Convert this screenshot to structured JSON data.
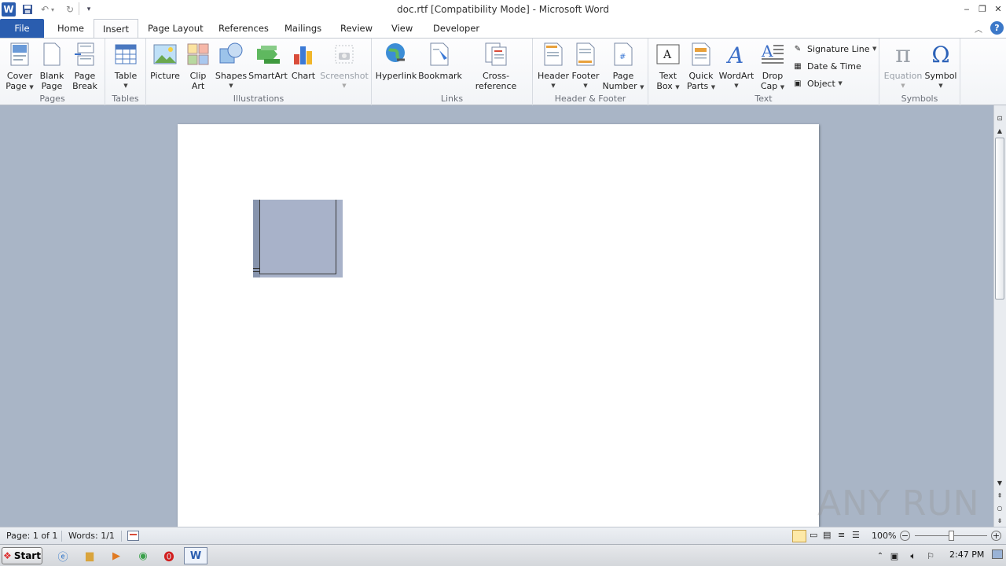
{
  "window": {
    "title": "doc.rtf [Compatibility Mode] - Microsoft Word"
  },
  "quick_access": {
    "customize_glyph": "▾"
  },
  "tabs": [
    {
      "label": "File"
    },
    {
      "label": "Home"
    },
    {
      "label": "Insert"
    },
    {
      "label": "Page Layout"
    },
    {
      "label": "References"
    },
    {
      "label": "Mailings"
    },
    {
      "label": "Review"
    },
    {
      "label": "View"
    },
    {
      "label": "Developer"
    }
  ],
  "ribbon": {
    "groups": {
      "pages": "Pages",
      "tables": "Tables",
      "illustrations": "Illustrations",
      "links": "Links",
      "header_footer": "Header & Footer",
      "text": "Text",
      "symbols": "Symbols"
    },
    "buttons": {
      "cover_page_1": "Cover",
      "cover_page_2": "Page",
      "blank_page_1": "Blank",
      "blank_page_2": "Page",
      "page_break_1": "Page",
      "page_break_2": "Break",
      "table": "Table",
      "picture": "Picture",
      "clip_art_1": "Clip",
      "clip_art_2": "Art",
      "shapes": "Shapes",
      "smartart": "SmartArt",
      "chart": "Chart",
      "screenshot": "Screenshot",
      "hyperlink": "Hyperlink",
      "bookmark": "Bookmark",
      "cross_reference": "Cross-reference",
      "header": "Header",
      "footer": "Footer",
      "page_number_1": "Page",
      "page_number_2": "Number",
      "text_box_1": "Text",
      "text_box_2": "Box",
      "quick_parts_1": "Quick",
      "quick_parts_2": "Parts",
      "wordart": "WordArt",
      "drop_cap_1": "Drop",
      "drop_cap_2": "Cap",
      "signature_line": "Signature Line",
      "date_time": "Date & Time",
      "object": "Object",
      "equation": "Equation",
      "symbol": "Symbol"
    }
  },
  "status": {
    "page": "Page: 1 of 1",
    "words": "Words: 1/1",
    "zoom": "100%"
  },
  "taskbar": {
    "start": "Start",
    "clock": "2:47 PM"
  },
  "watermark": "ANY RUN"
}
